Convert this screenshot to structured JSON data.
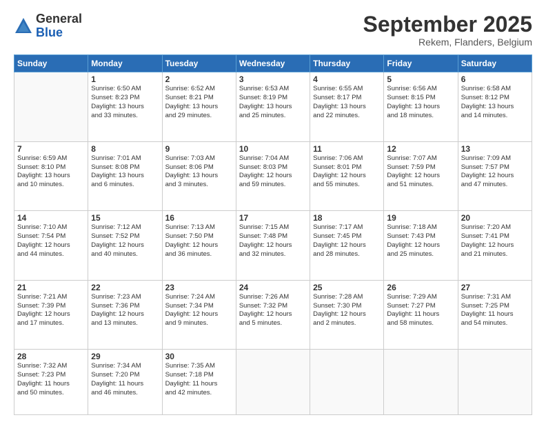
{
  "logo": {
    "general": "General",
    "blue": "Blue"
  },
  "header": {
    "month": "September 2025",
    "location": "Rekem, Flanders, Belgium"
  },
  "days_of_week": [
    "Sunday",
    "Monday",
    "Tuesday",
    "Wednesday",
    "Thursday",
    "Friday",
    "Saturday"
  ],
  "weeks": [
    [
      {
        "day": "",
        "info": ""
      },
      {
        "day": "1",
        "info": "Sunrise: 6:50 AM\nSunset: 8:23 PM\nDaylight: 13 hours\nand 33 minutes."
      },
      {
        "day": "2",
        "info": "Sunrise: 6:52 AM\nSunset: 8:21 PM\nDaylight: 13 hours\nand 29 minutes."
      },
      {
        "day": "3",
        "info": "Sunrise: 6:53 AM\nSunset: 8:19 PM\nDaylight: 13 hours\nand 25 minutes."
      },
      {
        "day": "4",
        "info": "Sunrise: 6:55 AM\nSunset: 8:17 PM\nDaylight: 13 hours\nand 22 minutes."
      },
      {
        "day": "5",
        "info": "Sunrise: 6:56 AM\nSunset: 8:15 PM\nDaylight: 13 hours\nand 18 minutes."
      },
      {
        "day": "6",
        "info": "Sunrise: 6:58 AM\nSunset: 8:12 PM\nDaylight: 13 hours\nand 14 minutes."
      }
    ],
    [
      {
        "day": "7",
        "info": "Sunrise: 6:59 AM\nSunset: 8:10 PM\nDaylight: 13 hours\nand 10 minutes."
      },
      {
        "day": "8",
        "info": "Sunrise: 7:01 AM\nSunset: 8:08 PM\nDaylight: 13 hours\nand 6 minutes."
      },
      {
        "day": "9",
        "info": "Sunrise: 7:03 AM\nSunset: 8:06 PM\nDaylight: 13 hours\nand 3 minutes."
      },
      {
        "day": "10",
        "info": "Sunrise: 7:04 AM\nSunset: 8:03 PM\nDaylight: 12 hours\nand 59 minutes."
      },
      {
        "day": "11",
        "info": "Sunrise: 7:06 AM\nSunset: 8:01 PM\nDaylight: 12 hours\nand 55 minutes."
      },
      {
        "day": "12",
        "info": "Sunrise: 7:07 AM\nSunset: 7:59 PM\nDaylight: 12 hours\nand 51 minutes."
      },
      {
        "day": "13",
        "info": "Sunrise: 7:09 AM\nSunset: 7:57 PM\nDaylight: 12 hours\nand 47 minutes."
      }
    ],
    [
      {
        "day": "14",
        "info": "Sunrise: 7:10 AM\nSunset: 7:54 PM\nDaylight: 12 hours\nand 44 minutes."
      },
      {
        "day": "15",
        "info": "Sunrise: 7:12 AM\nSunset: 7:52 PM\nDaylight: 12 hours\nand 40 minutes."
      },
      {
        "day": "16",
        "info": "Sunrise: 7:13 AM\nSunset: 7:50 PM\nDaylight: 12 hours\nand 36 minutes."
      },
      {
        "day": "17",
        "info": "Sunrise: 7:15 AM\nSunset: 7:48 PM\nDaylight: 12 hours\nand 32 minutes."
      },
      {
        "day": "18",
        "info": "Sunrise: 7:17 AM\nSunset: 7:45 PM\nDaylight: 12 hours\nand 28 minutes."
      },
      {
        "day": "19",
        "info": "Sunrise: 7:18 AM\nSunset: 7:43 PM\nDaylight: 12 hours\nand 25 minutes."
      },
      {
        "day": "20",
        "info": "Sunrise: 7:20 AM\nSunset: 7:41 PM\nDaylight: 12 hours\nand 21 minutes."
      }
    ],
    [
      {
        "day": "21",
        "info": "Sunrise: 7:21 AM\nSunset: 7:39 PM\nDaylight: 12 hours\nand 17 minutes."
      },
      {
        "day": "22",
        "info": "Sunrise: 7:23 AM\nSunset: 7:36 PM\nDaylight: 12 hours\nand 13 minutes."
      },
      {
        "day": "23",
        "info": "Sunrise: 7:24 AM\nSunset: 7:34 PM\nDaylight: 12 hours\nand 9 minutes."
      },
      {
        "day": "24",
        "info": "Sunrise: 7:26 AM\nSunset: 7:32 PM\nDaylight: 12 hours\nand 5 minutes."
      },
      {
        "day": "25",
        "info": "Sunrise: 7:28 AM\nSunset: 7:30 PM\nDaylight: 12 hours\nand 2 minutes."
      },
      {
        "day": "26",
        "info": "Sunrise: 7:29 AM\nSunset: 7:27 PM\nDaylight: 11 hours\nand 58 minutes."
      },
      {
        "day": "27",
        "info": "Sunrise: 7:31 AM\nSunset: 7:25 PM\nDaylight: 11 hours\nand 54 minutes."
      }
    ],
    [
      {
        "day": "28",
        "info": "Sunrise: 7:32 AM\nSunset: 7:23 PM\nDaylight: 11 hours\nand 50 minutes."
      },
      {
        "day": "29",
        "info": "Sunrise: 7:34 AM\nSunset: 7:20 PM\nDaylight: 11 hours\nand 46 minutes."
      },
      {
        "day": "30",
        "info": "Sunrise: 7:35 AM\nSunset: 7:18 PM\nDaylight: 11 hours\nand 42 minutes."
      },
      {
        "day": "",
        "info": ""
      },
      {
        "day": "",
        "info": ""
      },
      {
        "day": "",
        "info": ""
      },
      {
        "day": "",
        "info": ""
      }
    ]
  ]
}
